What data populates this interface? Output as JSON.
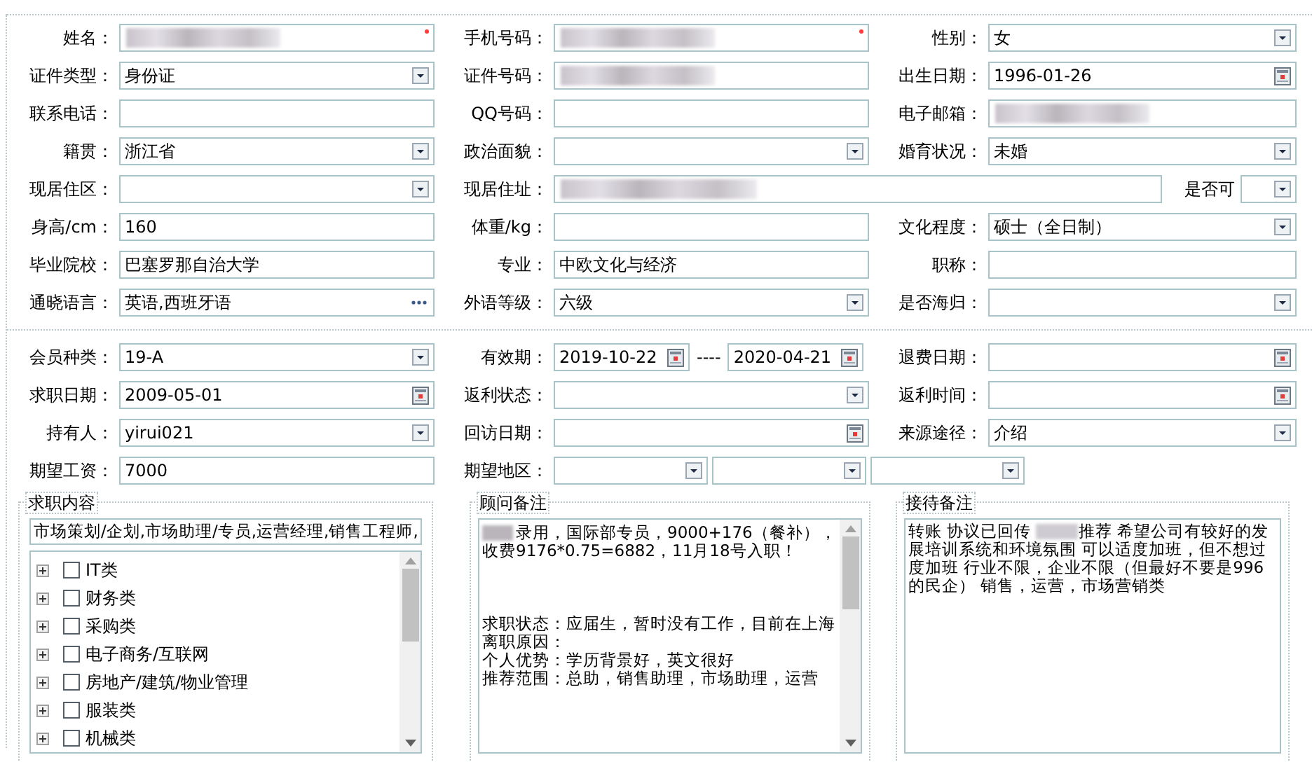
{
  "basic_info": {
    "rows": [
      [
        {
          "label": "姓名：",
          "kind": "text",
          "redacted": true,
          "required": true
        },
        {
          "label": "手机号码：",
          "kind": "text",
          "redacted": true,
          "required": true
        },
        {
          "label": "性别：",
          "kind": "select",
          "value": "女"
        }
      ],
      [
        {
          "label": "证件类型：",
          "kind": "select",
          "value": "身份证"
        },
        {
          "label": "证件号码：",
          "kind": "text",
          "redacted": true
        },
        {
          "label": "出生日期：",
          "kind": "date",
          "value": "1996-01-26"
        }
      ],
      [
        {
          "label": "联系电话：",
          "kind": "text"
        },
        {
          "label": "QQ号码：",
          "kind": "text"
        },
        {
          "label": "电子邮箱：",
          "kind": "text",
          "redacted": true
        }
      ],
      [
        {
          "label": "籍贯：",
          "kind": "select",
          "value": "浙江省"
        },
        {
          "label": "政治面貌：",
          "kind": "select"
        },
        {
          "label": "婚育状况：",
          "kind": "select",
          "value": "未婚"
        }
      ],
      [
        {
          "label": "现居住区：",
          "kind": "select"
        },
        {
          "label": "现居住址：",
          "kind": "text",
          "redacted": true,
          "extra": {
            "label": "是否可",
            "kind": "select"
          }
        }
      ],
      [
        {
          "label": "身高/cm：",
          "kind": "text",
          "value": "160"
        },
        {
          "label": "体重/kg：",
          "kind": "text"
        },
        {
          "label": "文化程度：",
          "kind": "select",
          "value": "硕士（全日制）"
        }
      ],
      [
        {
          "label": "毕业院校：",
          "kind": "text",
          "value": "巴塞罗那自治大学"
        },
        {
          "label": "专业：",
          "kind": "text",
          "value": "中欧文化与经济"
        },
        {
          "label": "职称：",
          "kind": "text"
        }
      ],
      [
        {
          "label": "通晓语言：",
          "kind": "picker",
          "value": "英语,西班牙语"
        },
        {
          "label": "外语等级：",
          "kind": "select",
          "value": "六级"
        },
        {
          "label": "是否海归：",
          "kind": "select"
        }
      ]
    ]
  },
  "membership": {
    "rows": [
      [
        {
          "label": "会员种类：",
          "kind": "select",
          "value": "19-A"
        },
        {
          "label": "有效期：",
          "kind": "date_range",
          "values": [
            "2019-10-22",
            "2020-04-21"
          ],
          "separator": "----"
        },
        {
          "label": "退费日期：",
          "kind": "date"
        }
      ],
      [
        {
          "label": "求职日期：",
          "kind": "date",
          "value": "2009-05-01"
        },
        {
          "label": "返利状态：",
          "kind": "select"
        },
        {
          "label": "返利时间：",
          "kind": "date"
        }
      ],
      [
        {
          "label": "持有人：",
          "kind": "select",
          "value": "yirui021"
        },
        {
          "label": "回访日期：",
          "kind": "date"
        },
        {
          "label": "来源途径：",
          "kind": "select",
          "value": "介绍"
        }
      ],
      [
        {
          "label": "期望工资：",
          "kind": "text",
          "value": "7000"
        },
        {
          "label": "期望地区：",
          "kind": "region"
        }
      ]
    ]
  },
  "job_content": {
    "title": "求职内容",
    "summary": "市场策划/企划,市场助理/专员,运营经理,销售工程师,",
    "tree": [
      {
        "label": "IT类",
        "checked": false,
        "expanded": false
      },
      {
        "label": "财务类",
        "checked": false,
        "expanded": false
      },
      {
        "label": "采购类",
        "checked": false,
        "expanded": false
      },
      {
        "label": "电子商务/互联网",
        "checked": false,
        "expanded": false
      },
      {
        "label": "房地产/建筑/物业管理",
        "checked": false,
        "expanded": false
      },
      {
        "label": "服装类",
        "checked": false,
        "expanded": false
      },
      {
        "label": "机械类",
        "checked": false,
        "expanded": false
      }
    ]
  },
  "advisor_notes": {
    "title": "顾问备注",
    "lines": [
      {
        "text": "录用，国际部专员，9000+176（餐补），收费9176*0.75=6882，11月18号入职！",
        "redacted_prefix": true
      },
      {
        "text": "求职状态：应届生，暂时没有工作，目前在上海",
        "gap_before": true
      },
      {
        "text": "离职原因："
      },
      {
        "text": "个人优势：学历背景好，英文很好"
      },
      {
        "text": "推荐范围：总助，销售助理，市场助理，运营"
      }
    ]
  },
  "reception_notes": {
    "title": "接待备注",
    "before": "转账 协议已回传 ",
    "after": "推荐 希望公司有较好的发展培训系统和环境氛围 可以适度加班，但不想过度加班 行业不限，企业不限（但最好不要是996的民企） 销售，运营，市场营销类"
  }
}
